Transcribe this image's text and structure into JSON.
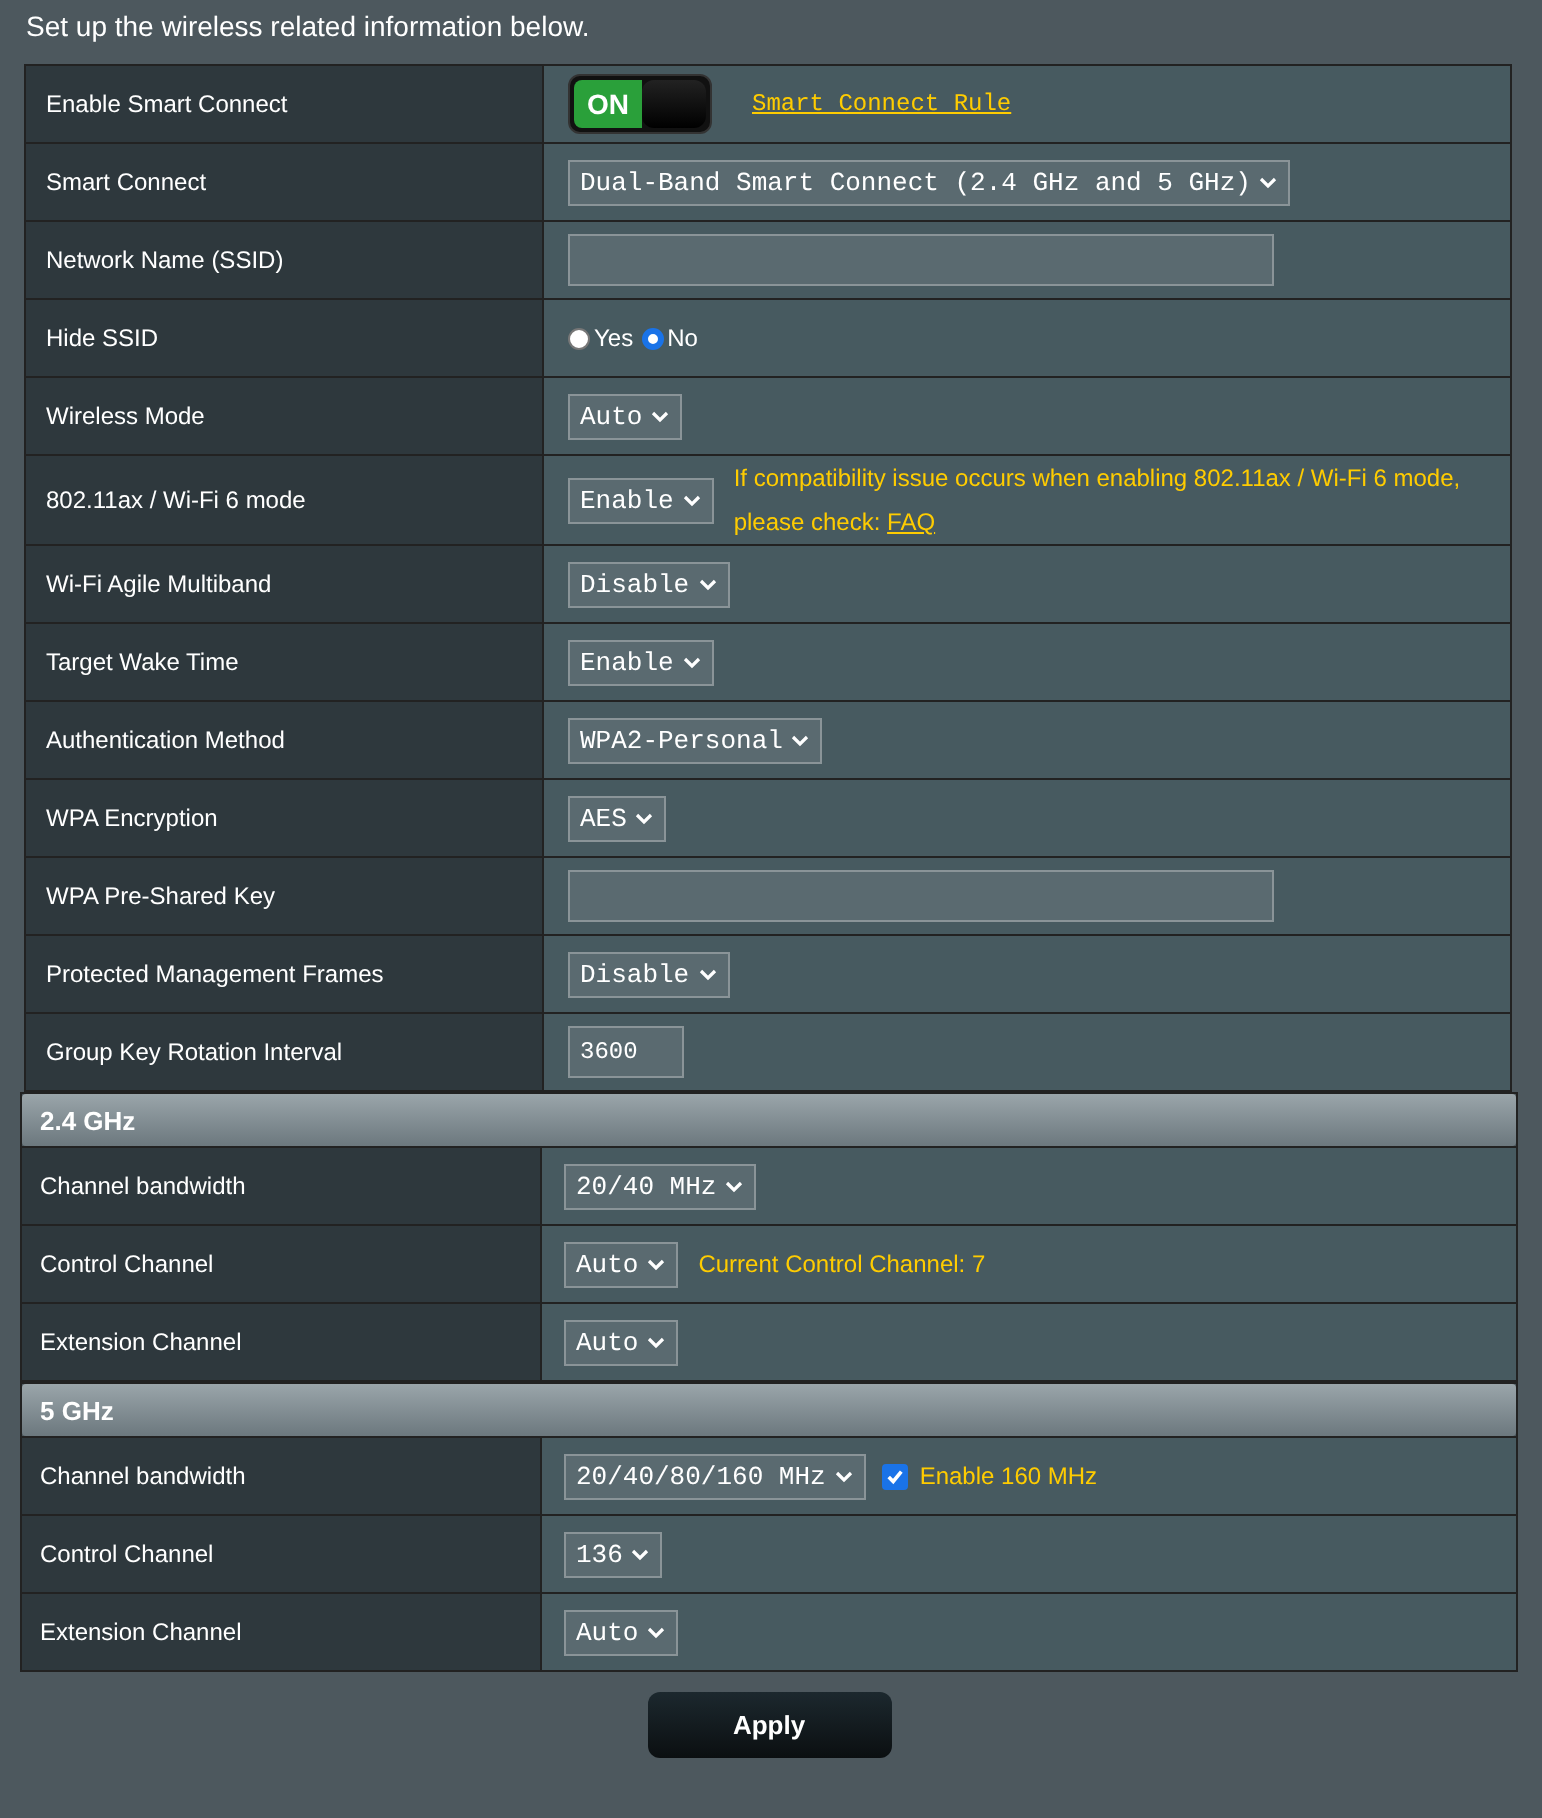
{
  "intro": "Set up the wireless related information below.",
  "settings": [
    {
      "label": "Enable Smart Connect",
      "controls": [
        {
          "kind": "toggle",
          "on": true,
          "text": "ON"
        },
        {
          "kind": "link",
          "text": "Smart Connect Rule"
        }
      ]
    },
    {
      "label": "Smart Connect",
      "controls": [
        {
          "kind": "select",
          "value": "Dual-Band Smart Connect (2.4 GHz and 5 GHz)"
        }
      ]
    },
    {
      "label": "Network Name (SSID)",
      "controls": [
        {
          "kind": "wide-field"
        }
      ]
    },
    {
      "label": "Hide SSID",
      "controls": [
        {
          "kind": "radio",
          "options": [
            {
              "label": "Yes",
              "selected": false
            },
            {
              "label": "No",
              "selected": true
            }
          ]
        }
      ]
    },
    {
      "label": "Wireless Mode",
      "controls": [
        {
          "kind": "select",
          "value": "Auto"
        }
      ]
    },
    {
      "label": "802.11ax / Wi-Fi 6 mode",
      "controls": [
        {
          "kind": "select",
          "value": "Enable"
        },
        {
          "kind": "note",
          "text": "If compatibility issue occurs when enabling 802.11ax / Wi-Fi 6 mode, please check:",
          "link": "FAQ"
        }
      ]
    },
    {
      "label": "Wi-Fi Agile Multiband",
      "controls": [
        {
          "kind": "select",
          "value": "Disable"
        }
      ]
    },
    {
      "label": "Target Wake Time",
      "controls": [
        {
          "kind": "select",
          "value": "Enable"
        }
      ]
    },
    {
      "label": "Authentication Method",
      "controls": [
        {
          "kind": "select",
          "value": "WPA2-Personal"
        }
      ]
    },
    {
      "label": "WPA Encryption",
      "controls": [
        {
          "kind": "select",
          "value": "AES"
        }
      ]
    },
    {
      "label": "WPA Pre-Shared Key",
      "controls": [
        {
          "kind": "wide-field"
        }
      ]
    },
    {
      "label": "Protected Management Frames",
      "controls": [
        {
          "kind": "select",
          "value": "Disable"
        }
      ]
    },
    {
      "label": "Group Key Rotation Interval",
      "controls": [
        {
          "kind": "short-field",
          "value": "3600"
        }
      ]
    }
  ],
  "bands": [
    {
      "title": "2.4 GHz",
      "rows": [
        {
          "label": "Channel bandwidth",
          "controls": [
            {
              "kind": "select",
              "value": "20/40 MHz"
            }
          ]
        },
        {
          "label": "Control Channel",
          "controls": [
            {
              "kind": "select",
              "value": "Auto"
            },
            {
              "kind": "note",
              "text": "Current Control Channel: 7"
            }
          ]
        },
        {
          "label": "Extension Channel",
          "controls": [
            {
              "kind": "select",
              "value": "Auto"
            }
          ]
        }
      ]
    },
    {
      "title": "5 GHz",
      "rows": [
        {
          "label": "Channel bandwidth",
          "controls": [
            {
              "kind": "select",
              "value": "20/40/80/160 MHz"
            },
            {
              "kind": "checkbox",
              "checked": true,
              "label": "Enable 160 MHz"
            }
          ]
        },
        {
          "label": "Control Channel",
          "controls": [
            {
              "kind": "select",
              "value": "136"
            }
          ]
        },
        {
          "label": "Extension Channel",
          "controls": [
            {
              "kind": "select",
              "value": "Auto"
            }
          ]
        }
      ]
    }
  ],
  "apply_button": "Apply"
}
